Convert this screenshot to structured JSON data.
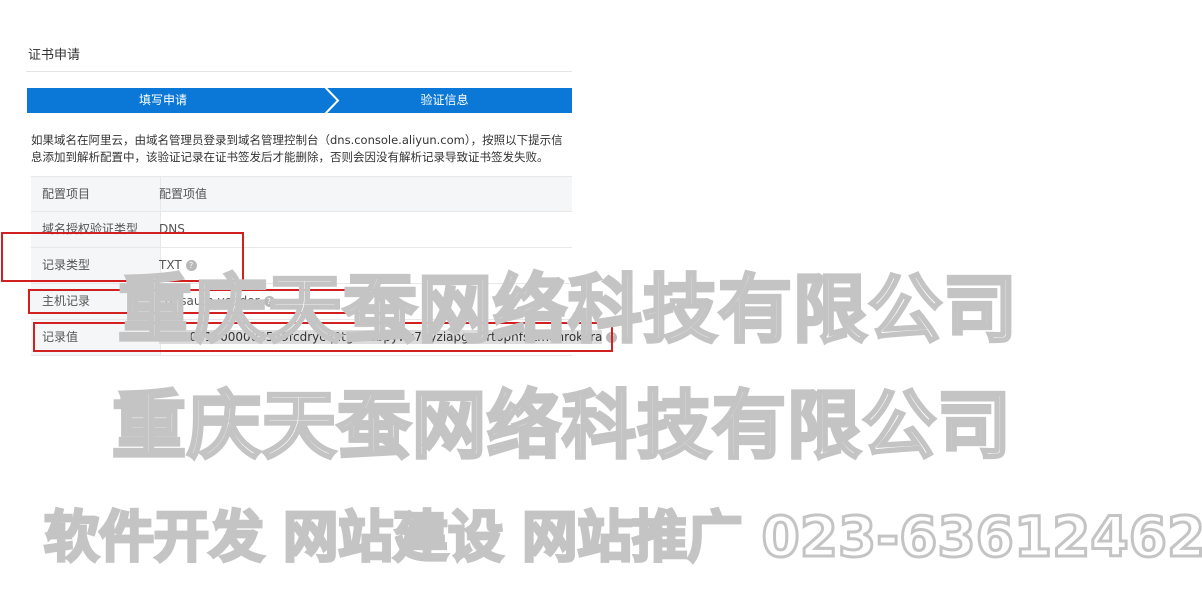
{
  "page_title": "证书申请",
  "steps": [
    {
      "label": "填写申请"
    },
    {
      "label": "验证信息"
    }
  ],
  "description": {
    "line1": "如果域名在阿里云，由域名管理员登录到域名管理控制台（dns.console.aliyun.com），按照以下提示信",
    "line2": "息添加到解析配置中，该验证记录在证书签发后才能删除，否则会因没有解析记录导致证书签发失败。"
  },
  "table": {
    "header": {
      "key": "配置项目",
      "value": "配置项值"
    },
    "rows": [
      {
        "key": "域名授权验证类型",
        "value": "DNS"
      },
      {
        "key": "记录类型",
        "value": "TXT"
      },
      {
        "key": "主机记录",
        "value": "_dnsauth.vendor"
      },
      {
        "key": "记录值",
        "value": "20200816000003529fcdrycq2tgv5dbpyws7dyziapgw4rt6pnfsitm0nrokkra"
      }
    ]
  },
  "icons": {
    "help": "question-circle-icon"
  },
  "watermark": {
    "line1": "重庆天蚕网络科技有限公司",
    "line2": "重庆天蚕网络科技有限公司",
    "line3": "软件开发 网站建设  网站推广  023-63612462"
  },
  "colors": {
    "step_bar": "#0b78d7",
    "annotation": "#d21f1f",
    "selection": "#dcdcdc"
  }
}
